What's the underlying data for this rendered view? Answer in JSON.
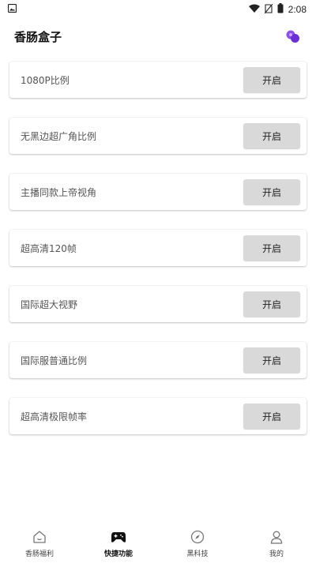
{
  "status_bar": {
    "time": "2:08",
    "icons": [
      "image-icon",
      "wifi-icon",
      "no-sim-icon",
      "battery-icon"
    ]
  },
  "header": {
    "title": "香肠盒子",
    "action_icon": "gem-icon",
    "accent_color": "#7b3fe4"
  },
  "features": [
    {
      "label": "1080P比例",
      "button": "开启"
    },
    {
      "label": "无黑边超广角比例",
      "button": "开启"
    },
    {
      "label": "主播同款上帝视角",
      "button": "开启"
    },
    {
      "label": "超高清120帧",
      "button": "开启"
    },
    {
      "label": "国际超大视野",
      "button": "开启"
    },
    {
      "label": "国际服普通比例",
      "button": "开启"
    },
    {
      "label": "超高清极限帧率",
      "button": "开启"
    }
  ],
  "bottom_nav": {
    "items": [
      {
        "label": "香肠福利",
        "icon": "home-icon",
        "active": false
      },
      {
        "label": "快捷功能",
        "icon": "gamepad-icon",
        "active": true
      },
      {
        "label": "黑科技",
        "icon": "compass-icon",
        "active": false
      },
      {
        "label": "我的",
        "icon": "person-icon",
        "active": false
      }
    ]
  }
}
